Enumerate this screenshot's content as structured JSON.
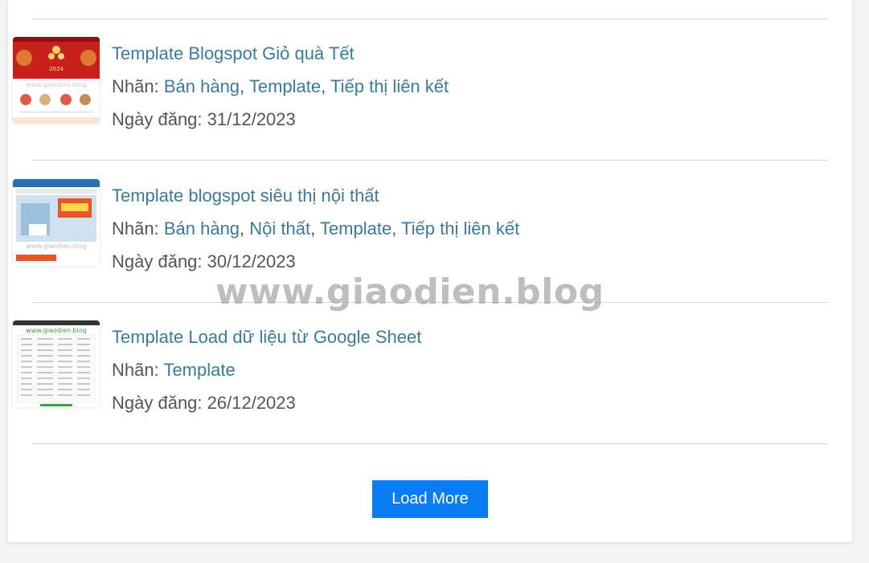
{
  "posts": [
    {
      "title": "Template Blogspot Giỏ quà Tết",
      "labels_prefix": "Nhãn:",
      "labels": [
        "Bán hàng",
        "Template",
        "Tiếp thị liên kết"
      ],
      "date_prefix": "Ngày đăng:",
      "date": "31/12/2023",
      "thumb_text": "www.giaodien.blog",
      "thumb_year": "2024"
    },
    {
      "title": "Template blogspot siêu thị nội thất",
      "labels_prefix": "Nhãn:",
      "labels": [
        "Bán hàng",
        "Nội thất",
        "Template",
        "Tiếp thị liên kết"
      ],
      "date_prefix": "Ngày đăng:",
      "date": "30/12/2023",
      "thumb_text": "www.giaodien.blog"
    },
    {
      "title": "Template Load dữ liệu từ Google Sheet",
      "labels_prefix": "Nhãn:",
      "labels": [
        "Template"
      ],
      "date_prefix": "Ngày đăng:",
      "date": "26/12/2023",
      "thumb_text": "www.giaodien.blog"
    }
  ],
  "load_more_label": "Load More",
  "watermark": "www.giaodien.blog",
  "colors": {
    "link": "#3b7a9a",
    "text": "#555555",
    "button": "#0a7cf4",
    "divider": "#d6d6d6"
  }
}
